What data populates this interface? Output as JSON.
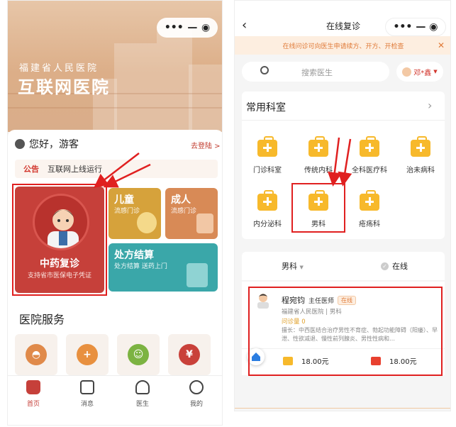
{
  "left": {
    "hero": {
      "hospital_name": "福建省人民医院",
      "hospital_title": "互联网医院"
    },
    "greeting": "您好，游客",
    "logout_label": "去登陆 >",
    "notice": {
      "tag": "公告",
      "text": "互联网上线运行"
    },
    "tiles": {
      "tcm": {
        "title": "中药复诊",
        "subtitle": "支持省市医保电子凭证"
      },
      "children": {
        "title": "儿童",
        "subtitle": "流感门诊"
      },
      "adult": {
        "title": "成人",
        "subtitle": "流感门诊"
      },
      "prescription": {
        "title": "处方结算",
        "subtitle": "处方结算 送药上门"
      }
    },
    "services_title": "医院服务",
    "tabbar": [
      {
        "label": "首页"
      },
      {
        "label": "消息"
      },
      {
        "label": "医生"
      },
      {
        "label": "我的"
      }
    ]
  },
  "right": {
    "nav_title": "在线复诊",
    "banner_text": "在线问诊可向医生申请续方、开方、开检查",
    "search_placeholder": "搜索医生",
    "city": "邓*鑫",
    "dept_title": "常用科室",
    "departments": [
      {
        "label": "门诊科室"
      },
      {
        "label": "传统内科"
      },
      {
        "label": "全科医疗科"
      },
      {
        "label": "治未病科"
      },
      {
        "label": "内分泌科"
      },
      {
        "label": "男科"
      },
      {
        "label": "疮疡科"
      }
    ],
    "filter": {
      "dept": "男科",
      "online": "在线"
    },
    "doctor": {
      "name": "程宛钧",
      "title": "主任医师",
      "badge": "在线",
      "hospital": "福建省人民医院 | 男科",
      "count": "问诊量 0",
      "specialty": "擅长：中西医结合治疗男性不育症、勃起功能障碍（阳痿）、早泄、性欲减退、慢性前列腺炎、男性性病和…",
      "price_image": "18.00元",
      "price_video": "18.00元"
    }
  },
  "colors": {
    "brand_red": "#c6403a",
    "highlight_red": "#e02020",
    "dept_yellow": "#f7b92b",
    "orange": "#e07b39"
  }
}
